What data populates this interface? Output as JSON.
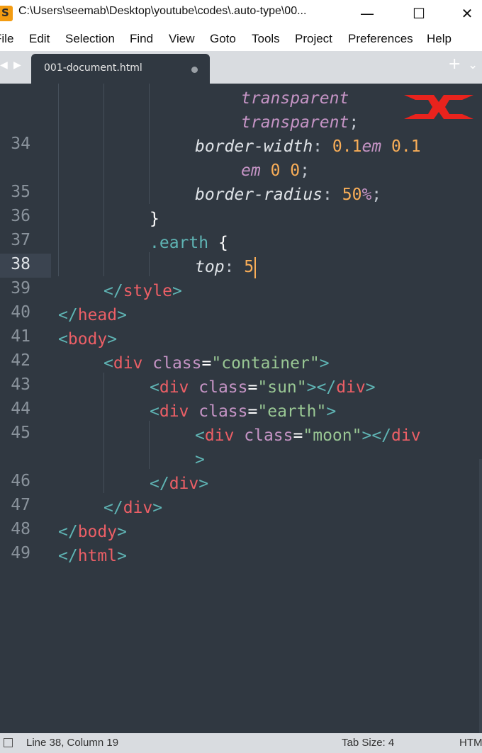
{
  "window": {
    "title": "C:\\Users\\seemab\\Desktop\\youtube\\codes\\.auto-type\\00...",
    "minimize_glyph": "—",
    "maximize_glyph": "☐",
    "close_glyph": "✕",
    "app_icon": "sublime-text-icon"
  },
  "menu": [
    "File",
    "Edit",
    "Selection",
    "Find",
    "View",
    "Goto",
    "Tools",
    "Project",
    "Preferences",
    "Help"
  ],
  "tabs": {
    "nav_left": "◀",
    "nav_right": "▶",
    "active_tab": "001-document.html",
    "plus": "+",
    "chevron": "⌄"
  },
  "gutter": [
    "",
    "",
    "34",
    "",
    "35",
    "36",
    "37",
    "38",
    "39",
    "40",
    "41",
    "42",
    "43",
    "44",
    "45",
    "",
    "46",
    "47",
    "48",
    "49"
  ],
  "active_line_number": "38",
  "code": {
    "l0": {
      "val": "transparent"
    },
    "l1": {
      "val": "transparent",
      "semi": ";"
    },
    "l2": {
      "prop": "border-width",
      "colon": ":",
      "n1": "0.1",
      "u1": "em",
      "n2": "0.1"
    },
    "l3": {
      "u1": "em",
      "n1": "0",
      "n2": "0",
      "semi": ";"
    },
    "l4": {
      "prop": "border-radius",
      "colon": ":",
      "n1": "50",
      "u1": "%",
      "semi": ";"
    },
    "l5": {
      "brace": "}"
    },
    "l6": {
      "sel": ".earth",
      "brace": "{"
    },
    "l7": {
      "prop": "top",
      "colon": ":",
      "n1": "5"
    },
    "l8": {
      "open": "</",
      "tag": "style",
      "close": ">"
    },
    "l9": {
      "open": "</",
      "tag": "head",
      "close": ">"
    },
    "l10": {
      "open": "<",
      "tag": "body",
      "close": ">"
    },
    "l11": {
      "open": "<",
      "tag": "div",
      "attr": "class",
      "eq": "=",
      "str": "\"container\"",
      "close": ">"
    },
    "l12": {
      "open": "<",
      "tag": "div",
      "attr": "class",
      "eq": "=",
      "str": "\"sun\"",
      "close": ">",
      "open2": "</",
      "tag2": "div",
      "close2": ">"
    },
    "l13": {
      "open": "<",
      "tag": "div",
      "attr": "class",
      "eq": "=",
      "str": "\"earth\"",
      "close": ">"
    },
    "l14": {
      "open": "<",
      "tag": "div",
      "attr": "class",
      "eq": "=",
      "str": "\"moon\"",
      "close": ">",
      "open2": "</",
      "tag2": "div"
    },
    "l15": {
      "close": ">"
    },
    "l16": {
      "open": "</",
      "tag": "div",
      "close": ">"
    },
    "l17": {
      "open": "</",
      "tag": "div",
      "close": ">"
    },
    "l18": {
      "open": "</",
      "tag": "body",
      "close": ">"
    },
    "l19": {
      "open": "</",
      "tag": "html",
      "close": ">"
    }
  },
  "overlay_logo": "red-x-logo-icon",
  "status": {
    "position": "Line 38, Column 19",
    "tab_size": "Tab Size: 4",
    "syntax": "HTML",
    "panel_icon": "panel-toggle-icon"
  },
  "colors": {
    "editor_bg": "#303841",
    "tag": "#ec5f66",
    "string": "#99c794",
    "attribute": "#c594c5",
    "number": "#f9ae58",
    "selector": "#5fb4b4",
    "caret": "#f9ae58"
  }
}
